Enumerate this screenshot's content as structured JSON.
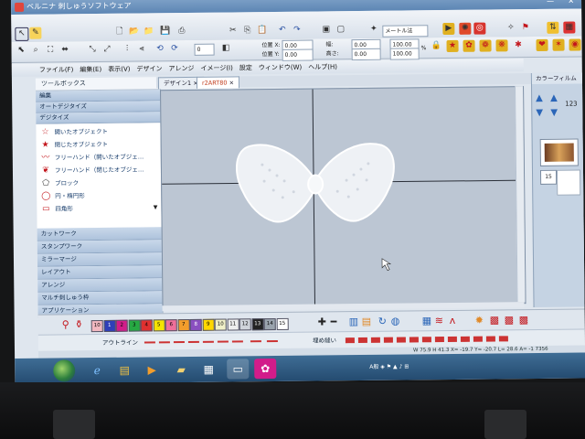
{
  "window": {
    "title": "ベルニナ 刺しゅうソフトウェア"
  },
  "toolbar": {
    "measure_mode": "メートル法",
    "pos_x_label": "位置 X:",
    "pos_y_label": "位置 Y:",
    "pos_x_value": "0.00",
    "pos_y_value": "0.00",
    "width_label": "幅:",
    "height_label": "高さ:",
    "width_value": "0.00",
    "height_value": "0.00",
    "scale_w": "100.00",
    "scale_h": "100.00",
    "rotate_value": "0",
    "percent": "%"
  },
  "menu": [
    "ファイル(F)",
    "編集(E)",
    "表示(V)",
    "デザイン",
    "アレンジ",
    "イメージ(I)",
    "設定",
    "ウィンドウ(W)",
    "ヘルプ(H)"
  ],
  "toolbox": {
    "title": "ツールボックス",
    "sections_top": [
      "編集",
      "オートデジタイズ",
      "デジタイズ"
    ],
    "digitize_items": [
      {
        "label": "開いたオブジェクト",
        "icon": "star-outline-icon"
      },
      {
        "label": "閉じたオブジェクト",
        "icon": "star-filled-icon"
      },
      {
        "label": "フリーハンド（開いたオブジェ…",
        "icon": "freehand-open-icon"
      },
      {
        "label": "フリーハンド（閉じたオブジェ…",
        "icon": "freehand-closed-icon"
      },
      {
        "label": "ブロック",
        "icon": "block-icon"
      },
      {
        "label": "円・楕円形",
        "icon": "circle-icon"
      },
      {
        "label": "四角形",
        "icon": "rectangle-icon"
      }
    ],
    "sections_bottom": [
      "カットワーク",
      "スタンプワーク",
      "ミラーマージ",
      "レイアウト",
      "アレンジ",
      "マルチ刺しゅう枠",
      "アプリケーション"
    ]
  },
  "tabs": [
    "デザイン1",
    "r2ART80"
  ],
  "right_panel": {
    "title": "カラーフィルム",
    "film_number": "15"
  },
  "palette": {
    "swatches": [
      {
        "n": "10",
        "color": "#f2b8c0"
      },
      {
        "n": "1",
        "color": "#2f3fb8"
      },
      {
        "n": "2",
        "color": "#d21c8a"
      },
      {
        "n": "3",
        "color": "#27a843"
      },
      {
        "n": "4",
        "color": "#e03030"
      },
      {
        "n": "5",
        "color": "#f5e400"
      },
      {
        "n": "6",
        "color": "#ef6f9a"
      },
      {
        "n": "7",
        "color": "#f29d2c"
      },
      {
        "n": "8",
        "color": "#8a4fc0"
      },
      {
        "n": "9",
        "color": "#ffd700"
      },
      {
        "n": "10",
        "color": "#f0f0c8"
      },
      {
        "n": "11",
        "color": "#eeeeee"
      },
      {
        "n": "12",
        "color": "#cfd4da"
      },
      {
        "n": "13",
        "color": "#222222"
      },
      {
        "n": "14",
        "color": "#9aa3ad"
      },
      {
        "n": "15",
        "color": "#ffffff"
      }
    ]
  },
  "outline": {
    "label": "アウトライン",
    "fill_label": "埋め縫い"
  },
  "status": {
    "text": "W 75.9 H 41.3   X= -19.7 Y= -20.7 L= 28.6 A= -1   7356"
  },
  "colors": {
    "accent_red": "#c3161c",
    "canvas_bg": "#bcc6d3",
    "panel_blue": "#aec3dc"
  }
}
